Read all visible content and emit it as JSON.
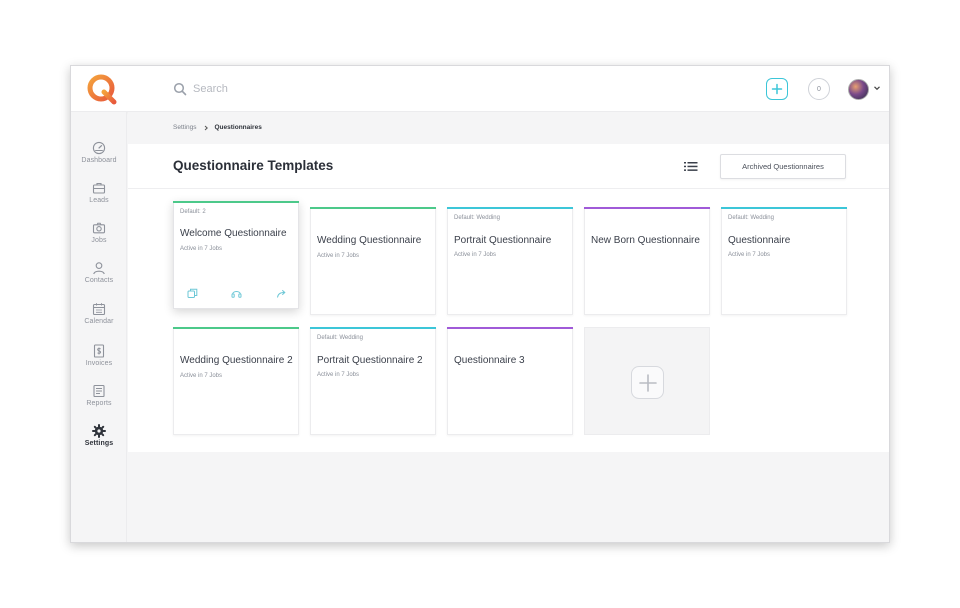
{
  "search": {
    "placeholder": "Search"
  },
  "header": {
    "notifications_count": "0"
  },
  "sidebar": {
    "items": [
      {
        "label": "Dashboard",
        "icon": "gauge-icon"
      },
      {
        "label": "Leads",
        "icon": "briefcase-icon"
      },
      {
        "label": "Jobs",
        "icon": "camera-icon"
      },
      {
        "label": "Contacts",
        "icon": "person-icon"
      },
      {
        "label": "Calendar",
        "icon": "calendar-icon"
      },
      {
        "label": "Invoices",
        "icon": "invoice-icon"
      },
      {
        "label": "Reports",
        "icon": "report-icon"
      },
      {
        "label": "Settings",
        "icon": "gear-icon",
        "active": true
      }
    ]
  },
  "breadcrumb": {
    "parent": "Settings",
    "current": "Questionnaires"
  },
  "page": {
    "title": "Questionnaire Templates",
    "archived_label": "Archived Questionnaires"
  },
  "cards": [
    {
      "default": "Default: 2",
      "title": "Welcome Questionnaire",
      "meta": "Active in 7 Jobs",
      "accent": "#4cc98a"
    },
    {
      "default": "",
      "title": "Wedding Questionnaire",
      "meta": "Active in 7 Jobs",
      "accent": "#4cc98a"
    },
    {
      "default": "Default: Wedding",
      "title": "Portrait Questionnaire",
      "meta": "Active in 7 Jobs",
      "accent": "#3cc6d8"
    },
    {
      "default": "",
      "title": "New Born Questionnaire",
      "meta": "",
      "accent": "#a05ad8"
    },
    {
      "default": "Default: Wedding",
      "title": "Questionnaire",
      "meta": "Active in 7 Jobs",
      "accent": "#3cc6d8"
    },
    {
      "default": "",
      "title": "Wedding Questionnaire 2",
      "meta": "Active in 7 Jobs",
      "accent": "#4cc98a"
    },
    {
      "default": "Default: Wedding",
      "title": "Portrait Questionnaire 2",
      "meta": "Active in 7 Jobs",
      "accent": "#3cc6d8"
    },
    {
      "default": "",
      "title": "Questionnaire 3",
      "meta": "",
      "accent": "#a05ad8"
    }
  ],
  "colors": {
    "accent_teal": "#3cc6d8",
    "accent_green": "#4cc98a",
    "accent_purple": "#a05ad8",
    "logo_orange": "#f08a3c"
  }
}
